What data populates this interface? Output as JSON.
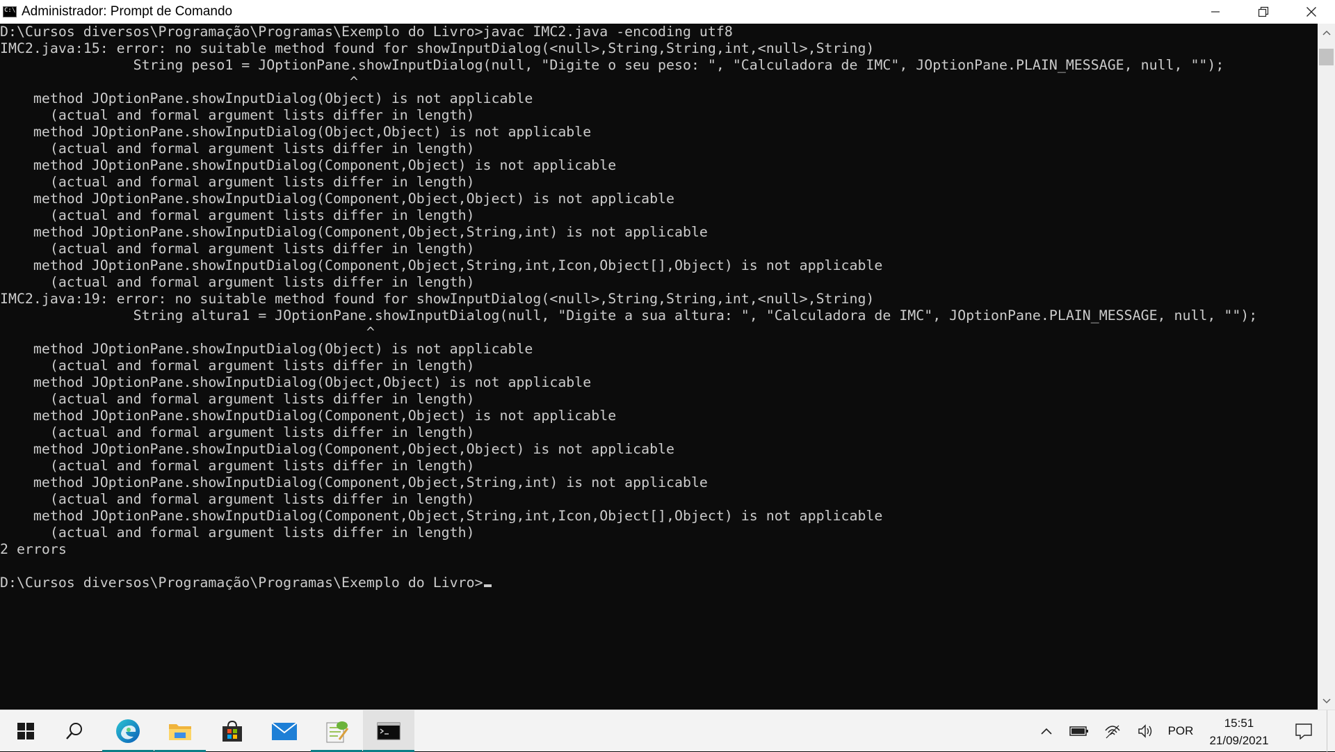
{
  "window": {
    "title": "Administrador: Prompt de Comando",
    "app_icon_text": "C:\\",
    "controls": [
      "minimize",
      "restore",
      "close"
    ]
  },
  "console": {
    "lines": [
      "D:\\Cursos diversos\\Programação\\Programas\\Exemplo do Livro>javac IMC2.java -encoding utf8",
      "IMC2.java:15: error: no suitable method found for showInputDialog(<null>,String,String,int,<null>,String)",
      "                String peso1 = JOptionPane.showInputDialog(null, \"Digite o seu peso: \", \"Calculadora de IMC\", JOptionPane.PLAIN_MESSAGE, null, \"\");",
      "                                          ^",
      "    method JOptionPane.showInputDialog(Object) is not applicable",
      "      (actual and formal argument lists differ in length)",
      "    method JOptionPane.showInputDialog(Object,Object) is not applicable",
      "      (actual and formal argument lists differ in length)",
      "    method JOptionPane.showInputDialog(Component,Object) is not applicable",
      "      (actual and formal argument lists differ in length)",
      "    method JOptionPane.showInputDialog(Component,Object,Object) is not applicable",
      "      (actual and formal argument lists differ in length)",
      "    method JOptionPane.showInputDialog(Component,Object,String,int) is not applicable",
      "      (actual and formal argument lists differ in length)",
      "    method JOptionPane.showInputDialog(Component,Object,String,int,Icon,Object[],Object) is not applicable",
      "      (actual and formal argument lists differ in length)",
      "IMC2.java:19: error: no suitable method found for showInputDialog(<null>,String,String,int,<null>,String)",
      "                String altura1 = JOptionPane.showInputDialog(null, \"Digite a sua altura: \", \"Calculadora de IMC\", JOptionPane.PLAIN_MESSAGE, null, \"\");",
      "                                            ^",
      "    method JOptionPane.showInputDialog(Object) is not applicable",
      "      (actual and formal argument lists differ in length)",
      "    method JOptionPane.showInputDialog(Object,Object) is not applicable",
      "      (actual and formal argument lists differ in length)",
      "    method JOptionPane.showInputDialog(Component,Object) is not applicable",
      "      (actual and formal argument lists differ in length)",
      "    method JOptionPane.showInputDialog(Component,Object,Object) is not applicable",
      "      (actual and formal argument lists differ in length)",
      "    method JOptionPane.showInputDialog(Component,Object,String,int) is not applicable",
      "      (actual and formal argument lists differ in length)",
      "    method JOptionPane.showInputDialog(Component,Object,String,int,Icon,Object[],Object) is not applicable",
      "      (actual and formal argument lists differ in length)",
      "2 errors",
      ""
    ],
    "prompt": "D:\\Cursos diversos\\Programação\\Programas\\Exemplo do Livro>",
    "colors": {
      "background": "#0c0c0c",
      "foreground": "#cccccc"
    }
  },
  "taskbar": {
    "apps": [
      {
        "name": "start",
        "icon": "windows-logo-icon"
      },
      {
        "name": "search",
        "icon": "search-icon"
      },
      {
        "name": "edge",
        "icon": "edge-icon",
        "running": true
      },
      {
        "name": "file-explorer",
        "icon": "folder-icon",
        "running": true
      },
      {
        "name": "microsoft-store",
        "icon": "store-icon"
      },
      {
        "name": "mail",
        "icon": "mail-icon"
      },
      {
        "name": "notepad-plus",
        "icon": "notepad-icon",
        "running": true
      },
      {
        "name": "command-prompt",
        "icon": "terminal-icon",
        "running": true,
        "active": true
      }
    ],
    "tray": {
      "language": "POR",
      "time": "15:51",
      "date": "21/09/2021",
      "icons": [
        "chevron-up-icon",
        "battery-icon",
        "wifi-icon",
        "volume-icon",
        "notification-icon"
      ]
    },
    "accent": "#0a7d86"
  }
}
